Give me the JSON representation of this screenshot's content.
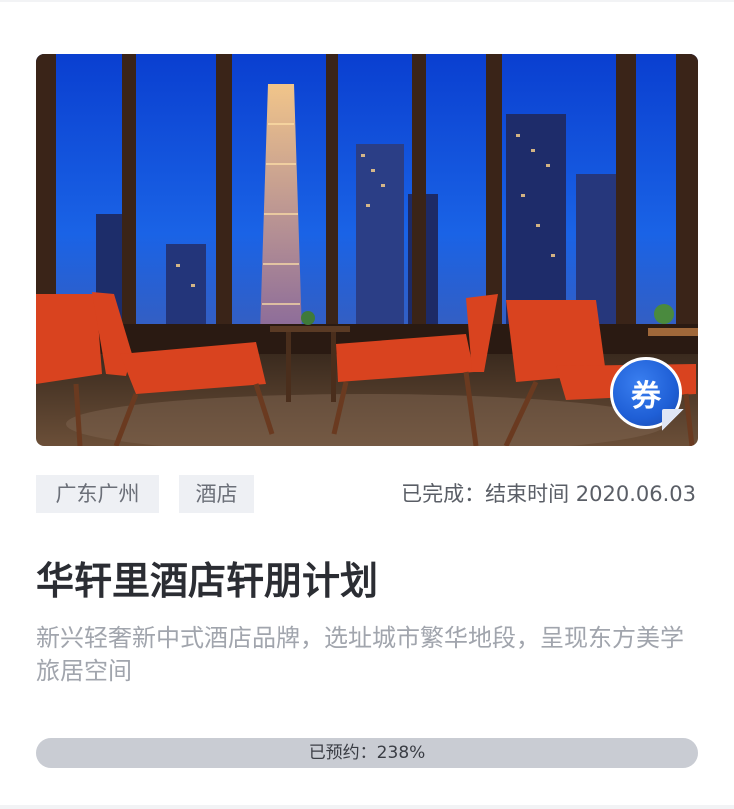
{
  "card": {
    "tags": [
      "广东广州",
      "酒店"
    ],
    "status": "已完成：结束时间 2020.06.03",
    "title": "华轩里酒店轩朋计划",
    "description": "新兴轻奢新中式酒店品牌，选址城市繁华地段，呈现东方美学旅居空间",
    "coupon_label": "券",
    "progress": {
      "label": "已预约：238%",
      "fill_fraction": 1.0
    },
    "hero_image": "hotel-lounge-night-city-view"
  },
  "colors": {
    "badge_blue": "#2a6be0",
    "chair_red": "#d9431f",
    "tag_bg": "#eef0f4",
    "progress_fill": "#c9ccd3"
  }
}
